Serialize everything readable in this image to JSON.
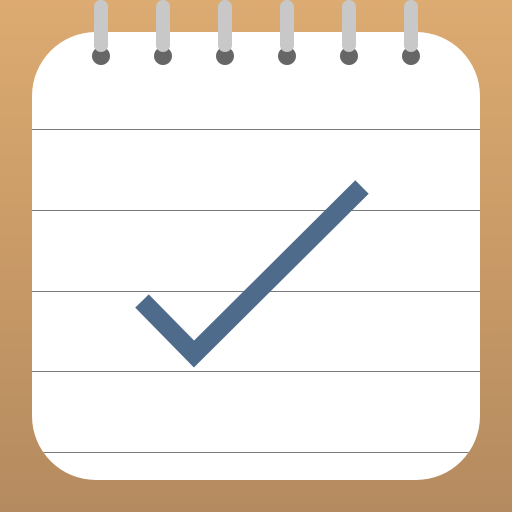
{
  "icon": {
    "name": "notes-checklist-app-icon",
    "colors": {
      "background_top": "#dcab72",
      "background_bottom": "#b48b60",
      "paper": "#ffffff",
      "rule_line": "#7a7a7a",
      "spiral_ring": "#c8c8c8",
      "spiral_hole": "#666666",
      "checkmark": "#4f6b8b"
    },
    "spiral_ring_count": 6,
    "rule_line_count": 5,
    "glyph": "checkmark-icon"
  }
}
